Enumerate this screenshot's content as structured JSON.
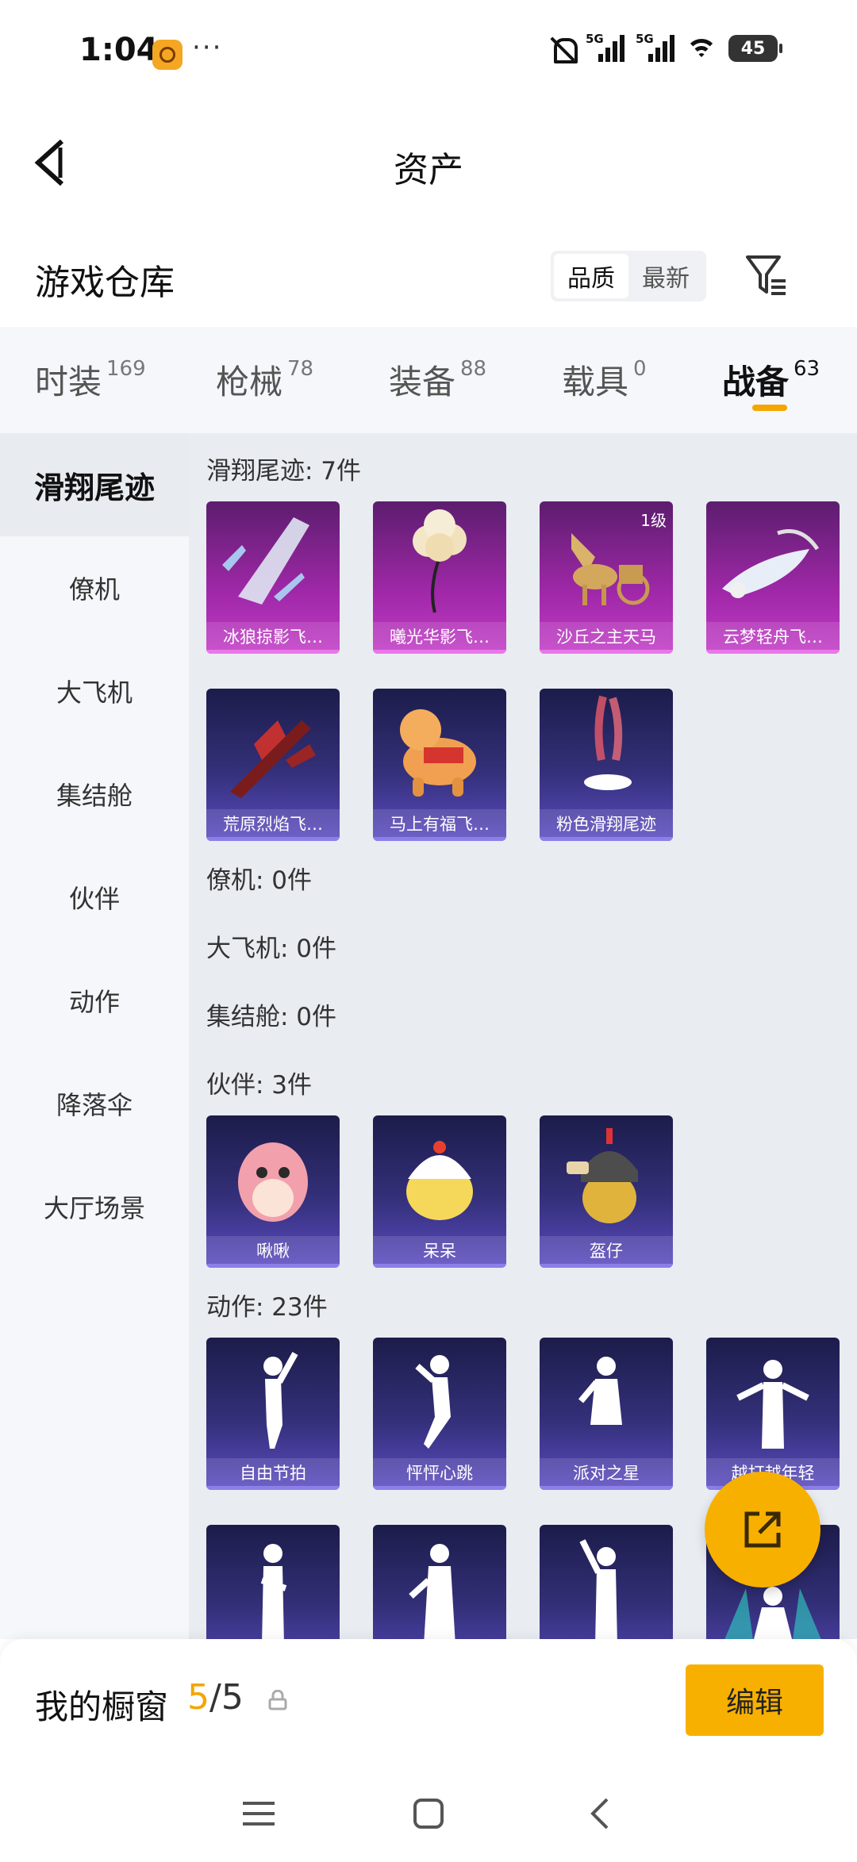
{
  "status_bar": {
    "time": "1:04",
    "more": "···",
    "signal1_label": "5G",
    "signal2_label": "5G",
    "battery": "45"
  },
  "header": {
    "title": "资产"
  },
  "warehouse": {
    "title": "游戏仓库",
    "sort_options": [
      "品质",
      "最新"
    ],
    "active_sort": "品质"
  },
  "tabs": [
    {
      "label": "时装",
      "count": "169"
    },
    {
      "label": "枪械",
      "count": "78"
    },
    {
      "label": "装备",
      "count": "88"
    },
    {
      "label": "载具",
      "count": "0"
    },
    {
      "label": "战备",
      "count": "63",
      "active": true
    }
  ],
  "sidebar": {
    "items": [
      "滑翔尾迹",
      "僚机",
      "大飞机",
      "集结舱",
      "伙伴",
      "动作",
      "降落伞",
      "大厅场景"
    ],
    "active_index": 0
  },
  "sections": {
    "glide": {
      "title": "滑翔尾迹: 7件",
      "items": [
        {
          "name": "冰狼掠影飞…",
          "style": "purple"
        },
        {
          "name": "曦光华影飞…",
          "style": "purple"
        },
        {
          "name": "沙丘之主天马",
          "style": "purple",
          "level": "1级"
        },
        {
          "name": "云梦轻舟飞…",
          "style": "purple"
        },
        {
          "name": "荒原烈焰飞…",
          "style": "blue"
        },
        {
          "name": "马上有福飞…",
          "style": "blue"
        },
        {
          "name": "粉色滑翔尾迹",
          "style": "blue"
        }
      ]
    },
    "wingman": {
      "title": "僚机: 0件"
    },
    "big_plane": {
      "title": "大飞机: 0件"
    },
    "pod": {
      "title": "集结舱: 0件"
    },
    "partner": {
      "title": "伙伴: 3件",
      "items": [
        {
          "name": "啾啾",
          "style": "blue"
        },
        {
          "name": "呆呆",
          "style": "blue"
        },
        {
          "name": "盔仔",
          "style": "blue"
        }
      ]
    },
    "action": {
      "title": "动作: 23件",
      "items": [
        {
          "name": "自由节拍",
          "style": "blue"
        },
        {
          "name": "怦怦心跳",
          "style": "blue"
        },
        {
          "name": "派对之星",
          "style": "blue"
        },
        {
          "name": "越打越年轻",
          "style": "blue"
        },
        {
          "name": "",
          "style": "blue"
        },
        {
          "name": "",
          "style": "blue"
        },
        {
          "name": "",
          "style": "blue"
        },
        {
          "name": "",
          "style": "blue"
        }
      ]
    }
  },
  "window": {
    "title": "我的橱窗",
    "current": "5",
    "separator": "/",
    "total": "5",
    "edit_label": "编辑"
  },
  "colors": {
    "accent": "#f7b000",
    "purple_card": "#a028a8",
    "blue_card": "#34307a"
  }
}
